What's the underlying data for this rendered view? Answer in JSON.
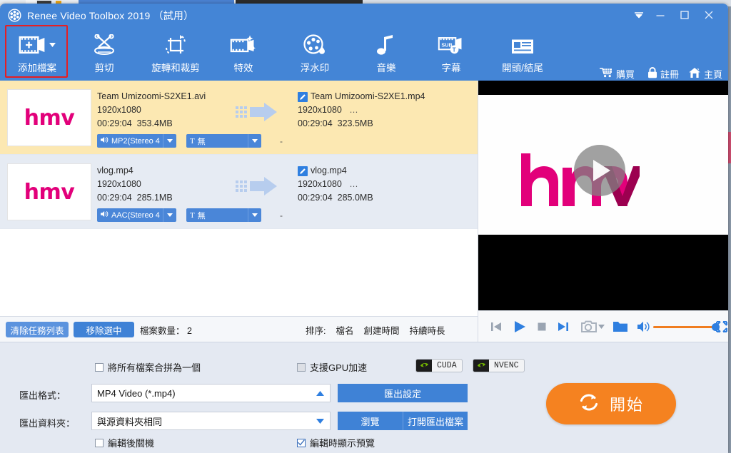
{
  "window": {
    "title": "Renee Video Toolbox 2019 （試用）",
    "logo_icon": "film-reel-icon",
    "controls": [
      {
        "name": "collapse-ribbon-button",
        "icon": "chevron-down-icon"
      },
      {
        "name": "minimize-button",
        "icon": "minimize-icon"
      },
      {
        "name": "maximize-button",
        "icon": "maximize-icon"
      },
      {
        "name": "close-button",
        "icon": "close-icon"
      }
    ]
  },
  "toolbar": {
    "items": [
      {
        "id": "add",
        "label": "添加檔案",
        "icon": "add-file-icon",
        "highlighted": true
      },
      {
        "id": "cut",
        "label": "剪切",
        "icon": "scissors-icon"
      },
      {
        "id": "rotate",
        "label": "旋轉和裁剪",
        "icon": "crop-rotate-icon"
      },
      {
        "id": "effect",
        "label": "特效",
        "icon": "effects-icon"
      },
      {
        "id": "watermark",
        "label": "浮水印",
        "icon": "watermark-icon"
      },
      {
        "id": "music",
        "label": "音樂",
        "icon": "music-note-icon"
      },
      {
        "id": "subtitle",
        "label": "字幕",
        "icon": "subtitle-icon"
      },
      {
        "id": "intro",
        "label": "開頭/結尾",
        "icon": "intro-outro-icon"
      }
    ],
    "links": [
      {
        "id": "buy",
        "label": "購買",
        "icon": "cart-icon"
      },
      {
        "id": "register",
        "label": "註冊",
        "icon": "lock-icon"
      },
      {
        "id": "home",
        "label": "主頁",
        "icon": "home-icon"
      }
    ],
    "highlight_color": "#e61e23",
    "bar_color": "#4485d6"
  },
  "file_list": {
    "rows": [
      {
        "selected": true,
        "thumbnail_text": "hmv",
        "source": {
          "name": "Team Umizoomi-S2XE1.avi",
          "resolution": "1920x1080",
          "duration": "00:29:04",
          "size": "353.4MB"
        },
        "output": {
          "name": "Team Umizoomi-S2XE1.mp4",
          "resolution": "1920x1080",
          "more": "…",
          "duration": "00:29:04",
          "size": "323.5MB"
        },
        "audio_track": "MP2(Stereo 4",
        "subtitle_track": "無",
        "extra": "-"
      },
      {
        "selected": false,
        "thumbnail_text": "hmv",
        "source": {
          "name": "vlog.mp4",
          "resolution": "1920x1080",
          "duration": "00:29:04",
          "size": "285.1MB"
        },
        "output": {
          "name": "vlog.mp4",
          "resolution": "1920x1080",
          "more": "…",
          "duration": "00:29:04",
          "size": "285.0MB"
        },
        "audio_track": "AAC(Stereo 4",
        "subtitle_track": "無",
        "extra": "-"
      }
    ]
  },
  "list_toolbar": {
    "clear_label": "清除任務列表",
    "remove_label": "移除選中",
    "count_label": "檔案數量：",
    "count_value": "2",
    "sort_label": "排序:",
    "sort_options": [
      "檔名",
      "創建時間",
      "持續時長"
    ]
  },
  "preview": {
    "logo_text": "hmv",
    "play_overlay_icon": "play-circle-icon",
    "controls": [
      {
        "name": "previous-button",
        "icon": "skip-previous-icon"
      },
      {
        "name": "play-button",
        "icon": "play-icon"
      },
      {
        "name": "stop-button",
        "icon": "stop-icon"
      },
      {
        "name": "next-button",
        "icon": "skip-next-icon"
      },
      {
        "name": "snapshot-button",
        "icon": "camera-icon"
      },
      {
        "name": "snapshot-menu-button",
        "icon": "caret-down-icon"
      },
      {
        "name": "open-folder-button",
        "icon": "folder-icon"
      },
      {
        "name": "volume-button",
        "icon": "speaker-icon"
      },
      {
        "name": "fullscreen-button",
        "icon": "fullscreen-icon"
      }
    ],
    "volume_track_color": "#f07d20",
    "volume_percent": 92
  },
  "settings": {
    "merge_label": "將所有檔案合拼為一個",
    "merge_checked": false,
    "gpu_label": "支援GPU加速",
    "gpu_checked": false,
    "badges": [
      {
        "id": "cuda",
        "label": "CUDA",
        "icon": "nvidia-eye-icon"
      },
      {
        "id": "nvenc",
        "label": "NVENC",
        "icon": "nvidia-eye-icon"
      }
    ],
    "format_label": "匯出格式：",
    "format_value": "MP4 Video (*.mp4)",
    "format_arrow": "caret-up-icon",
    "folder_label": "匯出資料夾：",
    "folder_value": "與源資料夾相同",
    "folder_arrow": "caret-down-icon",
    "export_settings_label": "匯出設定",
    "browse_label": "瀏覽",
    "open_output_label": "打開匯出檔案",
    "shutdown_label": "編輯後關機",
    "shutdown_checked": false,
    "preview_label": "編輯時顯示預覽",
    "preview_checked": true,
    "start_label": "開始",
    "start_icon": "refresh-cycle-icon",
    "start_color": "#f58220"
  }
}
